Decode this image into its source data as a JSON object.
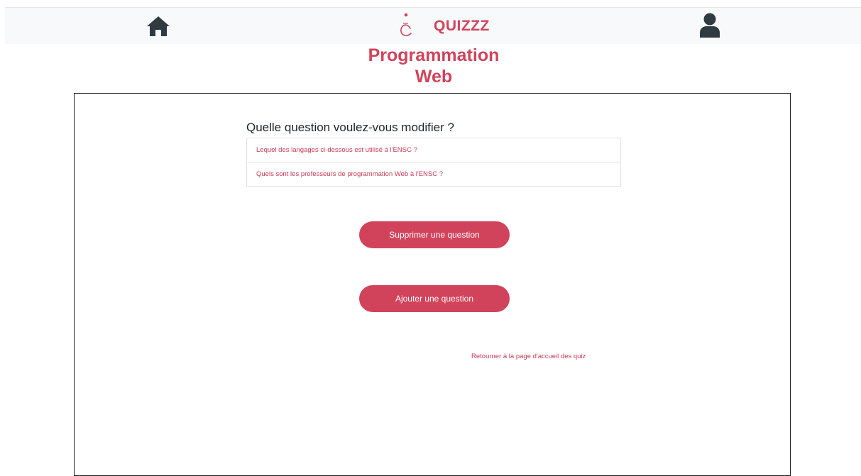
{
  "navbar": {
    "home_icon": "home-icon",
    "brand": {
      "logo_icon": "ensc-logo-icon",
      "text": "QUIZZZ"
    },
    "user_icon": "user-icon"
  },
  "quiz": {
    "title": "Programmation Web"
  },
  "edit_panel": {
    "heading": "Quelle question voulez-vous modifier ?",
    "questions": [
      "Lequel des langages ci-dessous est utilisé à l'ENSC ?",
      "Quels sont les professeurs de programmation Web à l'ENSC ?"
    ],
    "delete_button_label": "Supprimer une question",
    "add_button_label": "Ajouter une question",
    "back_link_label": "Retourner à la page d'accueil des quiz"
  },
  "colors": {
    "accent": "#d1435b",
    "navbar_bg": "#f8f9fa",
    "icon_dark": "#2f3a41"
  }
}
